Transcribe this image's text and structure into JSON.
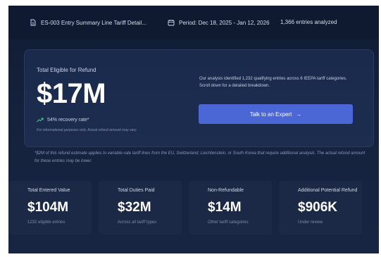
{
  "header": {
    "document_name": "ES-003 Entry Summary Line Tariff Detail...",
    "period_label": "Period: Dec 18, 2025 - Jan 12, 2026",
    "entries_label": "1,366 entries analyzed",
    "icons": [
      "document-icon",
      "calendar-icon"
    ]
  },
  "refund": {
    "label": "Total Eligible for Refund",
    "amount": "$17M",
    "recovery_rate": "54% recovery rate*",
    "disclaimer": "For informational purposes only. Actual refund amount may vary.",
    "description": "Our analysis identified 1,232 qualifying entries across 6 IEEPA tariff categories. Scroll down for a detailed breakdown.",
    "cta_label": "Talk to an Expert",
    "cta_arrow": "→"
  },
  "note": "*$2M of this refund estimate applies to variable-rate tariff lines from the EU, Switzerland, Liechtenstein, or South Korea that require additional analysis. The actual refund amount for these entries may be lower.",
  "stats": [
    {
      "title": "Total Entered Value",
      "value": "$104M",
      "sub": "1232 eligible entries"
    },
    {
      "title": "Total Duties Paid",
      "value": "$32M",
      "sub": "Across all tariff types"
    },
    {
      "title": "Non-Refundable",
      "value": "$14M",
      "sub": "Other tariff categories"
    },
    {
      "title": "Additional Potential Refund",
      "value": "$906K",
      "sub": "Under review"
    }
  ],
  "colors": {
    "background": "#111c33",
    "card": "#1a2a4c",
    "accent": "#4b67d6",
    "trend": "#4fd18b"
  }
}
